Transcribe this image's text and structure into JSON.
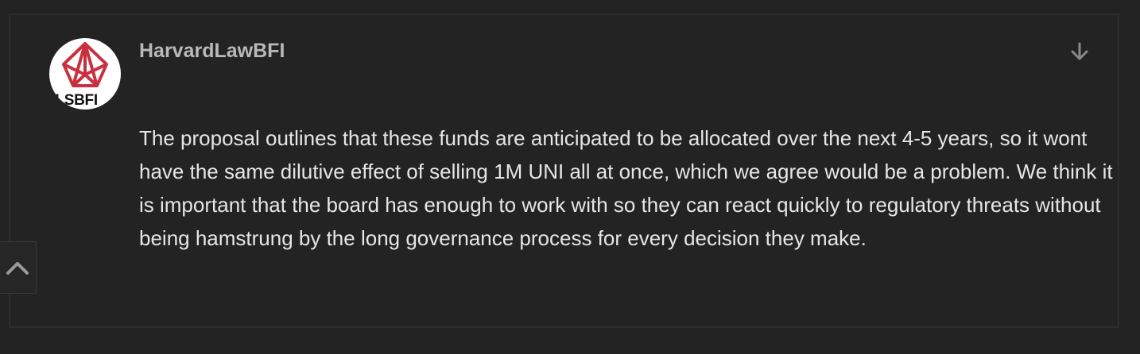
{
  "post": {
    "username": "HarvardLawBFI",
    "avatar": {
      "logo_text": "HLSBFI",
      "logo_color": "#c8303f"
    },
    "expand_icon": "arrow-down-icon",
    "body": "The proposal outlines that these funds are anticipated to be allocated over the next 4-5 years, so it wont have the same dilutive effect of selling 1M UNI all at once, which we agree would be a problem. We think it is important that the board has enough to work with so they can react quickly to regulatory threats without being hamstrung by the long governance process for every decision they make."
  },
  "scroll_top": {
    "icon": "chevron-up-icon"
  },
  "colors": {
    "background": "#222222",
    "text": "#e6e6e6",
    "username": "#b9b9b9",
    "icon": "#8a8a8a"
  }
}
